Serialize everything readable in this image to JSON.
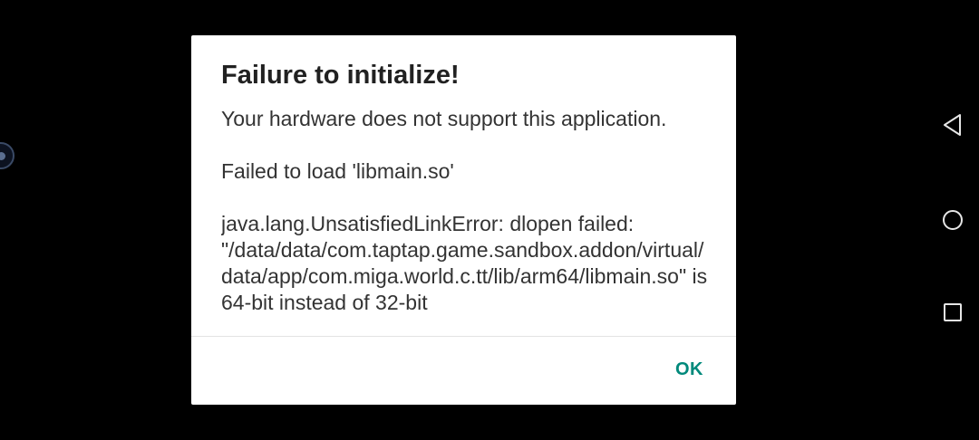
{
  "dialog": {
    "title": "Failure to initialize!",
    "message_1": "Your hardware does not support this application.",
    "message_2": "Failed to load 'libmain.so'",
    "message_3": "java.lang.UnsatisfiedLinkError: dlopen failed: \"/data/data/com.taptap.game.sandbox.addon/virtual/data/app/com.miga.world.c.tt/lib/arm64/libmain.so\" is 64-bit instead of 32-bit",
    "ok_label": "OK"
  },
  "colors": {
    "accent": "#00897b",
    "background": "#000000",
    "dialog_background": "#ffffff"
  },
  "navigation": {
    "icons": [
      "back-icon",
      "home-icon",
      "recents-icon"
    ]
  }
}
